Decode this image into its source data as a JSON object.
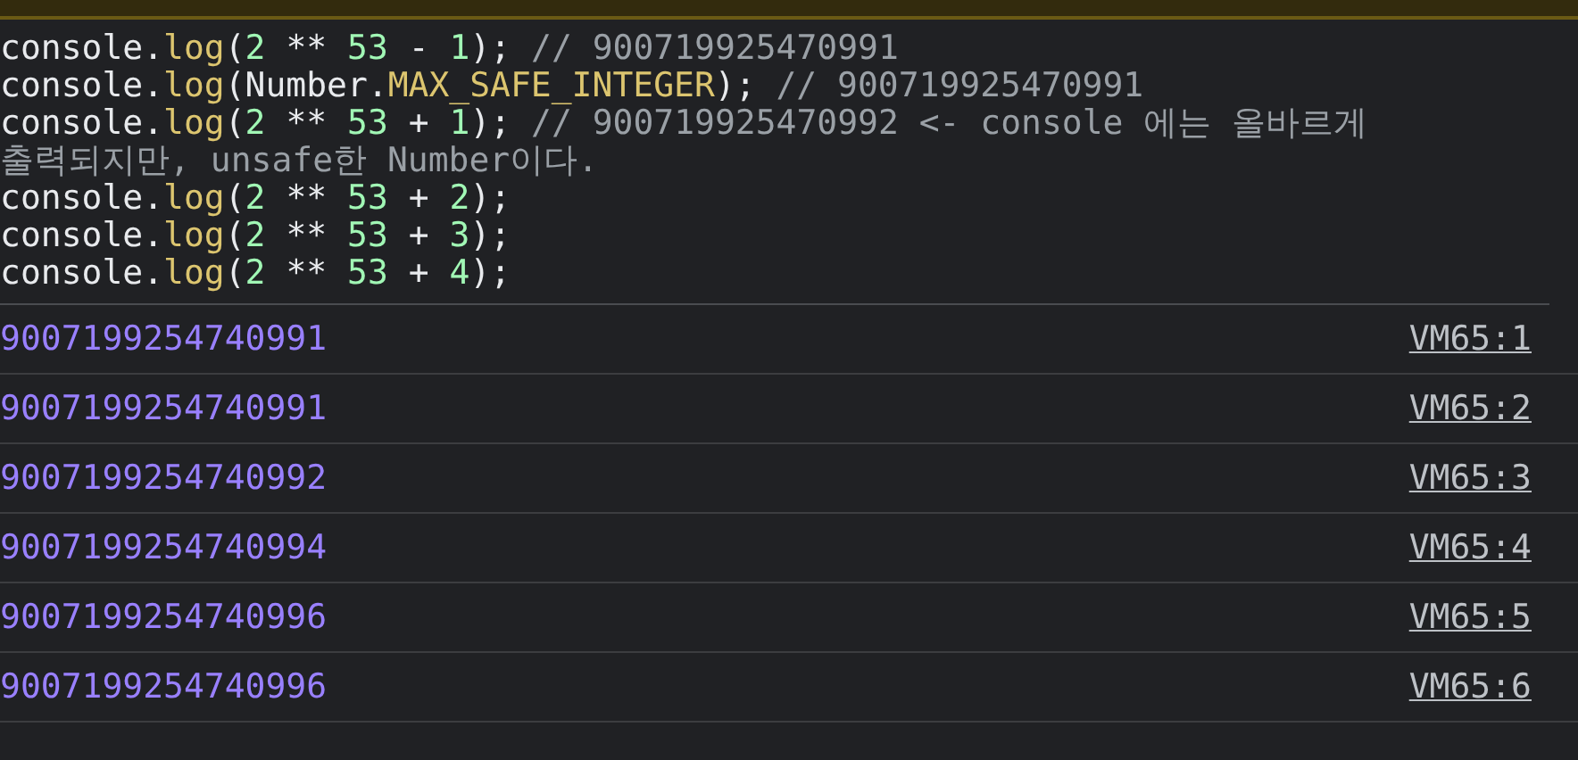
{
  "code_lines": [
    [
      {
        "kind": "plain",
        "text": "console."
      },
      {
        "kind": "method",
        "text": "log"
      },
      {
        "kind": "plain",
        "text": "("
      },
      {
        "kind": "number",
        "text": "2"
      },
      {
        "kind": "plain",
        "text": " ** "
      },
      {
        "kind": "number",
        "text": "53"
      },
      {
        "kind": "plain",
        "text": " - "
      },
      {
        "kind": "number",
        "text": "1"
      },
      {
        "kind": "plain",
        "text": "); "
      },
      {
        "kind": "comment",
        "text": "// 900719925470991"
      }
    ],
    [
      {
        "kind": "plain",
        "text": "console."
      },
      {
        "kind": "method",
        "text": "log"
      },
      {
        "kind": "plain",
        "text": "(Number."
      },
      {
        "kind": "method",
        "text": "MAX_SAFE_INTEGER"
      },
      {
        "kind": "plain",
        "text": "); "
      },
      {
        "kind": "comment",
        "text": "// 900719925470991"
      }
    ],
    [
      {
        "kind": "plain",
        "text": "console."
      },
      {
        "kind": "method",
        "text": "log"
      },
      {
        "kind": "plain",
        "text": "("
      },
      {
        "kind": "number",
        "text": "2"
      },
      {
        "kind": "plain",
        "text": " ** "
      },
      {
        "kind": "number",
        "text": "53"
      },
      {
        "kind": "plain",
        "text": " + "
      },
      {
        "kind": "number",
        "text": "1"
      },
      {
        "kind": "plain",
        "text": "); "
      },
      {
        "kind": "comment",
        "text": "// 900719925470992 <- console 에는 올바르게 출력되지만, unsafe한 Number이다."
      }
    ],
    [
      {
        "kind": "plain",
        "text": "console."
      },
      {
        "kind": "method",
        "text": "log"
      },
      {
        "kind": "plain",
        "text": "("
      },
      {
        "kind": "number",
        "text": "2"
      },
      {
        "kind": "plain",
        "text": " ** "
      },
      {
        "kind": "number",
        "text": "53"
      },
      {
        "kind": "plain",
        "text": " + "
      },
      {
        "kind": "number",
        "text": "2"
      },
      {
        "kind": "plain",
        "text": ");"
      }
    ],
    [
      {
        "kind": "plain",
        "text": "console."
      },
      {
        "kind": "method",
        "text": "log"
      },
      {
        "kind": "plain",
        "text": "("
      },
      {
        "kind": "number",
        "text": "2"
      },
      {
        "kind": "plain",
        "text": " ** "
      },
      {
        "kind": "number",
        "text": "53"
      },
      {
        "kind": "plain",
        "text": " + "
      },
      {
        "kind": "number",
        "text": "3"
      },
      {
        "kind": "plain",
        "text": ");"
      }
    ],
    [
      {
        "kind": "plain",
        "text": "console."
      },
      {
        "kind": "method",
        "text": "log"
      },
      {
        "kind": "plain",
        "text": "("
      },
      {
        "kind": "number",
        "text": "2"
      },
      {
        "kind": "plain",
        "text": " ** "
      },
      {
        "kind": "number",
        "text": "53"
      },
      {
        "kind": "plain",
        "text": " + "
      },
      {
        "kind": "number",
        "text": "4"
      },
      {
        "kind": "plain",
        "text": ");"
      }
    ]
  ],
  "outputs": [
    {
      "value": "9007199254740991",
      "source": "VM65:1"
    },
    {
      "value": "9007199254740991",
      "source": "VM65:2"
    },
    {
      "value": "9007199254740992",
      "source": "VM65:3"
    },
    {
      "value": "9007199254740994",
      "source": "VM65:4"
    },
    {
      "value": "9007199254740996",
      "source": "VM65:5"
    },
    {
      "value": "9007199254740996",
      "source": "VM65:6"
    }
  ]
}
